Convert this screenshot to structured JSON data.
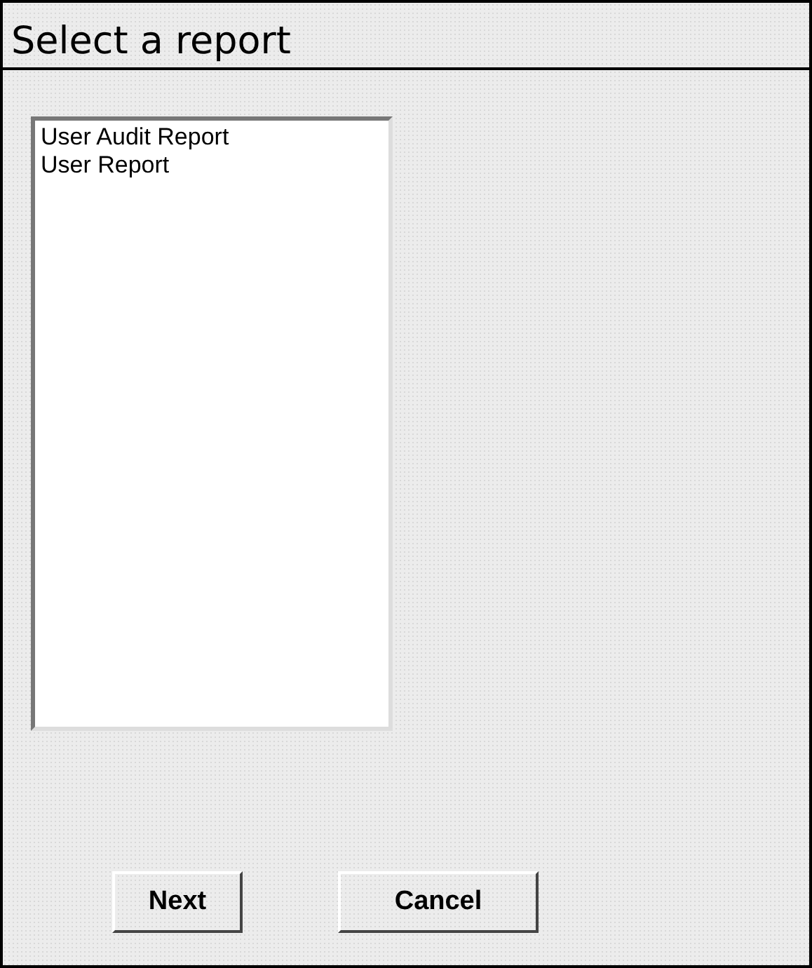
{
  "title": "Select a report",
  "reports": [
    {
      "label": "User Audit Report",
      "selected": false
    },
    {
      "label": "User Report",
      "selected": false
    }
  ],
  "buttons": [
    {
      "label": "Next"
    },
    {
      "label": "Cancel"
    }
  ]
}
